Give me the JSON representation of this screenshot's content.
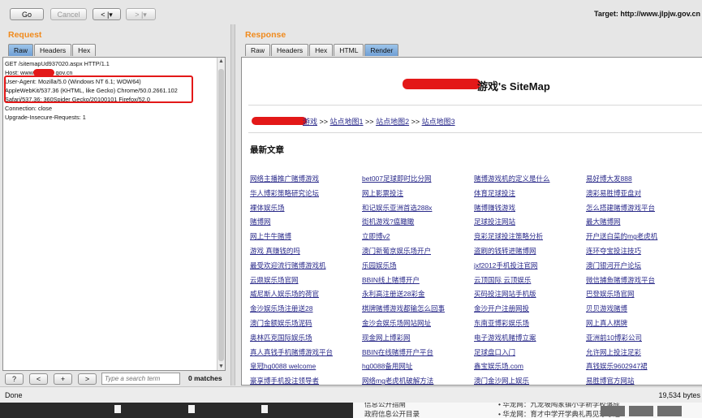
{
  "toolbar": {
    "go": "Go",
    "cancel": "Cancel",
    "back": "< |▾",
    "forward": "> |▾",
    "target_label": "Target: http://www.jlpjw.gov.cn"
  },
  "request": {
    "title": "Request",
    "tabs": [
      "Raw",
      "Headers",
      "Hex"
    ],
    "lines": [
      "GET /sitemapUd937020.aspx HTTP/1.1",
      "Host: www.",
      "User-Agent: Mozilla/5.0 (Windows NT 6.1; WOW64)",
      "AppleWebKit/537.36 (KHTML, like Gecko) Chrome/50.0.2661.102",
      "Safari/537.36; 360Spider Gecko/20100101 Firefox/52.0",
      "Connection: close",
      "Upgrade-Insecure-Requests: 1"
    ],
    "host_suffix": "gov.cn"
  },
  "search": {
    "help": "?",
    "prev": "<",
    "add": "+",
    "next": ">",
    "placeholder": "Type a search term",
    "matches": "0 matches"
  },
  "response": {
    "title": "Response",
    "tabs": [
      "Raw",
      "Headers",
      "Hex",
      "HTML",
      "Render"
    ],
    "site_title_suffix": "游戏's SiteMap",
    "crumb_suffix": "游戏",
    "crumb_sep": " >> ",
    "crumbs": [
      "站点地图1",
      "站点地图2",
      "站点地图3"
    ],
    "latest_heading": "最新文章",
    "articles": [
      [
        "网络主播推广赌博游戏",
        "bet007足球即时比分网",
        "赌博游戏机的定义是什么",
        "易好博大发888"
      ],
      [
        "华人博彩策略研究论坛",
        "网上影票投注",
        "体育足球投注",
        "澳彩易胜博亚盘对"
      ],
      [
        "裸体娱乐场",
        "和记娱乐亚洲首选288x",
        "赌博赚钱游戏",
        "怎么搭建赌博游戏平台"
      ],
      [
        "赌博网",
        "街机游戏?瘟瞰瞰",
        "足球投注网站",
        "最大赌博网"
      ],
      [
        "网上牛牛赌博",
        "立即博v2",
        "竞彩足球投注策略分析",
        "开户送白菜的mg老虎机"
      ],
      [
        "游戏 真赚钱的吗",
        "澳门新葡京娱乐场开户",
        "盗刷的钱转进赌博网",
        "连环夺宝投注技巧"
      ],
      [
        "最受欢迎流行赌博游戏机",
        "乐园娱乐场",
        "jxf2012手机投注官网",
        "澳门银河开户论坛"
      ],
      [
        "云鼎娱乐场官网",
        "BBIN线上赌博开户",
        "云顶国际 云顶娱乐",
        "微信捕鱼赌博游戏平台"
      ],
      [
        "威尼斯人娱乐场的荷官",
        "永利高注册送28彩金",
        "买码投注网站手机版",
        "巴登娱乐场官网"
      ],
      [
        "金沙娱乐场注册送28",
        "棋牌赌博游戏都输怎么回事",
        "金沙开户注册网投",
        "贝贝游戏赌博"
      ],
      [
        "澳门金额娱乐场泥码",
        "金沙会娱乐场网站网址",
        "东南亚博彩娱乐场",
        "网上真人棋牌"
      ],
      [
        "奥林匹克国际娱乐场",
        "现金网上博彩网",
        "电子游戏机赌博立案",
        "亚洲前10博彩公司"
      ],
      [
        "真人真钱手机赌博游戏平台",
        "BBIN在线赌博开户平台",
        "足球盘口入门",
        "允许网上投注足彩"
      ],
      [
        "皇冠hg0088 welcome",
        "hg0088备用网址",
        "鑫宝娱乐场.com",
        "真钱娱乐9602947裙"
      ],
      [
        "豪享博手机投注领导者",
        "网络mg老虎机破解方法",
        "澳门金沙网上娱乐",
        "易胜博官方网站"
      ]
    ]
  },
  "status": {
    "done": "Done",
    "bytes": "19,534 bytes"
  },
  "desktop": {
    "mid_line1": "信息公开指南",
    "mid_line2": "政府信息公开目录",
    "right_line1": "• 华龙网：九龙坡陶家镇小学新学校落成",
    "right_line2": "• 华龙网：育才中学开学典礼再见珍珍经"
  },
  "colors": {
    "accent": "#f08a1c",
    "highlight_box": "#e31818",
    "link": "#2a2a8a",
    "tab_active": "#7aa7dc"
  }
}
